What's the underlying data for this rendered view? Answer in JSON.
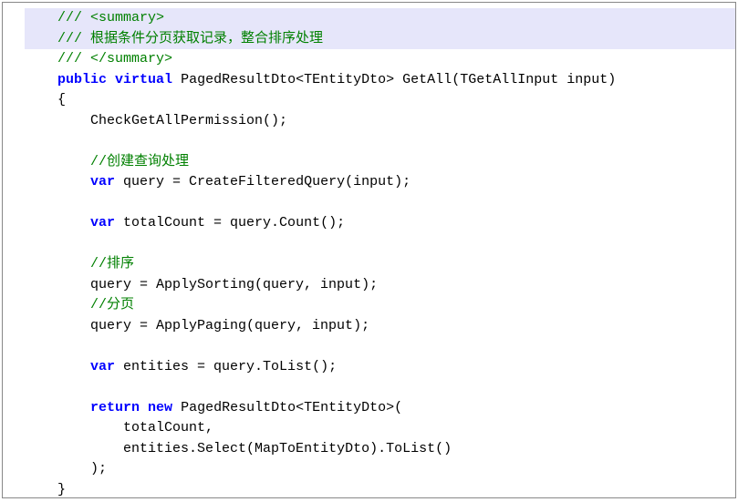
{
  "code": {
    "line1": {
      "comment_slashes": "/// ",
      "comment_tag": "<summary>"
    },
    "line2": {
      "comment_slashes": "/// ",
      "comment_text": "根据条件分页获取记录，整合排序处理"
    },
    "line3": {
      "comment_slashes": "/// ",
      "comment_tag": "</summary>"
    },
    "line4": {
      "kw_public": "public",
      "kw_virtual": "virtual",
      "type_paged": "PagedResultDto",
      "generic_open": "<",
      "type_entity": "TEntityDto",
      "generic_close": ">",
      "method_name": "GetAll",
      "paren_open": "(",
      "param_type": "TGetAllInput",
      "param_name": "input",
      "paren_close": ")"
    },
    "line5": {
      "brace": "{"
    },
    "line6": {
      "call": "CheckGetAllPermission();"
    },
    "line8": {
      "comment": "//创建查询处理"
    },
    "line9": {
      "kw_var": "var",
      "rest": " query = CreateFilteredQuery(input);"
    },
    "line11": {
      "kw_var": "var",
      "rest": " totalCount = query.Count();"
    },
    "line13": {
      "comment": "//排序"
    },
    "line14": {
      "stmt": "query = ApplySorting(query, input);"
    },
    "line15": {
      "comment": "//分页"
    },
    "line16": {
      "stmt": "query = ApplyPaging(query, input);"
    },
    "line18": {
      "kw_var": "var",
      "rest": " entities = query.ToList();"
    },
    "line20": {
      "kw_return": "return",
      "kw_new": "new",
      "type_paged": "PagedResultDto",
      "generic_open": "<",
      "type_entity": "TEntityDto",
      "generic_close": ">",
      "paren": "("
    },
    "line21": {
      "stmt": "totalCount,"
    },
    "line22": {
      "stmt": "entities.Select(MapToEntityDto).ToList()"
    },
    "line23": {
      "stmt": ");"
    },
    "line24": {
      "brace": "}"
    }
  }
}
